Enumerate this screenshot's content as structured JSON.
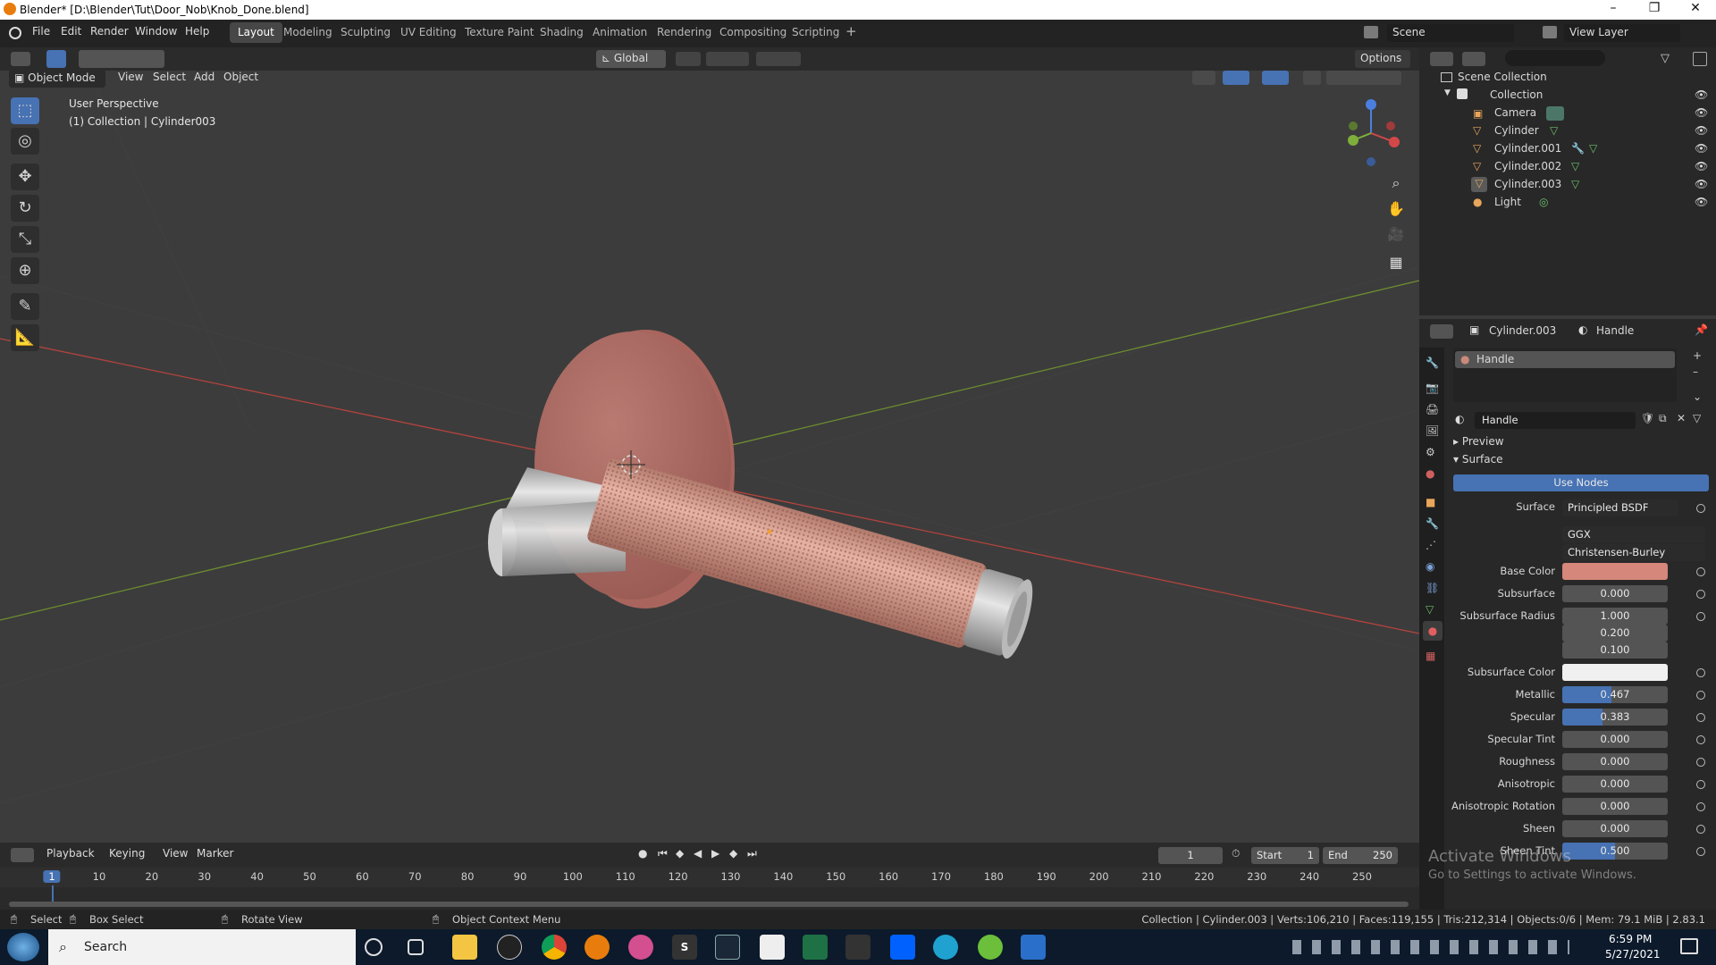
{
  "window": {
    "title": "Blender* [D:\\Blender\\Tut\\Door_Nob\\Knob_Done.blend]",
    "minimize": "–",
    "maximize": "❐",
    "close": "✕"
  },
  "menu": [
    "File",
    "Edit",
    "Render",
    "Window",
    "Help"
  ],
  "workspaces": [
    "Layout",
    "Modeling",
    "Sculpting",
    "UV Editing",
    "Texture Paint",
    "Shading",
    "Animation",
    "Rendering",
    "Compositing",
    "Scripting"
  ],
  "workspace_active": "Layout",
  "add_workspace": "+",
  "scene": {
    "label": "Scene",
    "view_layer": "View Layer"
  },
  "toolbar2": {
    "transform_orientation": "Global",
    "options": "Options"
  },
  "viewport_header": {
    "mode": "Object Mode",
    "items": [
      "View",
      "Select",
      "Add",
      "Object"
    ]
  },
  "viewport": {
    "perspective": "User Perspective",
    "collection_info": "(1) Collection | Cylinder003"
  },
  "gizmo": {
    "x": "X",
    "y": "Y",
    "z": "Z"
  },
  "outliner": {
    "root": "Scene Collection",
    "collection": "Collection",
    "items": [
      "Camera",
      "Cylinder",
      "Cylinder.001",
      "Cylinder.002",
      "Cylinder.003",
      "Light"
    ]
  },
  "props": {
    "object": "Cylinder.003",
    "material": "Handle",
    "slot_name": "Handle",
    "material_field": "Handle",
    "preview": "Preview",
    "surface_header": "Surface",
    "use_nodes": "Use Nodes",
    "surface_label": "Surface",
    "surface_value": "Principled BSDF",
    "distribution": "GGX",
    "subsurface_method": "Christensen-Burley",
    "rows": [
      {
        "label": "Base Color",
        "value": "",
        "type": "color",
        "color": "#d4877a"
      },
      {
        "label": "Subsurface",
        "value": "0.000",
        "type": "num"
      },
      {
        "label": "Subsurface Radius",
        "value": "1.000",
        "type": "num"
      },
      {
        "label": "",
        "value": "0.200",
        "type": "num"
      },
      {
        "label": "",
        "value": "0.100",
        "type": "num"
      },
      {
        "label": "Subsurface Color",
        "value": "",
        "type": "color",
        "color": "#f0f0f0"
      },
      {
        "label": "Metallic",
        "value": "0.467",
        "type": "slider",
        "fill": 0.467
      },
      {
        "label": "Specular",
        "value": "0.383",
        "type": "slider",
        "fill": 0.383
      },
      {
        "label": "Specular Tint",
        "value": "0.000",
        "type": "num"
      },
      {
        "label": "Roughness",
        "value": "0.000",
        "type": "num"
      },
      {
        "label": "Anisotropic",
        "value": "0.000",
        "type": "num"
      },
      {
        "label": "Anisotropic Rotation",
        "value": "0.000",
        "type": "num"
      },
      {
        "label": "Sheen",
        "value": "0.000",
        "type": "num"
      },
      {
        "label": "Sheen Tint",
        "value": "0.500",
        "type": "slider",
        "fill": 0.5
      }
    ]
  },
  "timeline": {
    "menus": [
      "Playback",
      "Keying",
      "View",
      "Marker"
    ],
    "current_frame": "1",
    "start_label": "Start",
    "start": "1",
    "end_label": "End",
    "end": "250",
    "ticks": [
      "1",
      "10",
      "20",
      "30",
      "40",
      "50",
      "60",
      "70",
      "80",
      "90",
      "100",
      "110",
      "120",
      "130",
      "140",
      "150",
      "160",
      "170",
      "180",
      "190",
      "200",
      "210",
      "220",
      "230",
      "240",
      "250"
    ]
  },
  "status": {
    "select": "Select",
    "box_select": "Box Select",
    "rotate": "Rotate View",
    "context": "Object Context Menu",
    "stats": "Collection | Cylinder.003 | Verts:106,210 | Faces:119,155 | Tris:212,314 | Objects:0/6 | Mem: 79.1 MiB | 2.83.1"
  },
  "watermark": {
    "line1": "Activate Windows",
    "line2": "Go to Settings to activate Windows."
  },
  "taskbar": {
    "search": "Search",
    "time": "6:59 PM",
    "date": "5/27/2021"
  },
  "colors": {
    "accent": "#4772b3",
    "knob": "#d4877a",
    "x_axis": "#c0463f",
    "y_axis": "#7ea23c"
  }
}
